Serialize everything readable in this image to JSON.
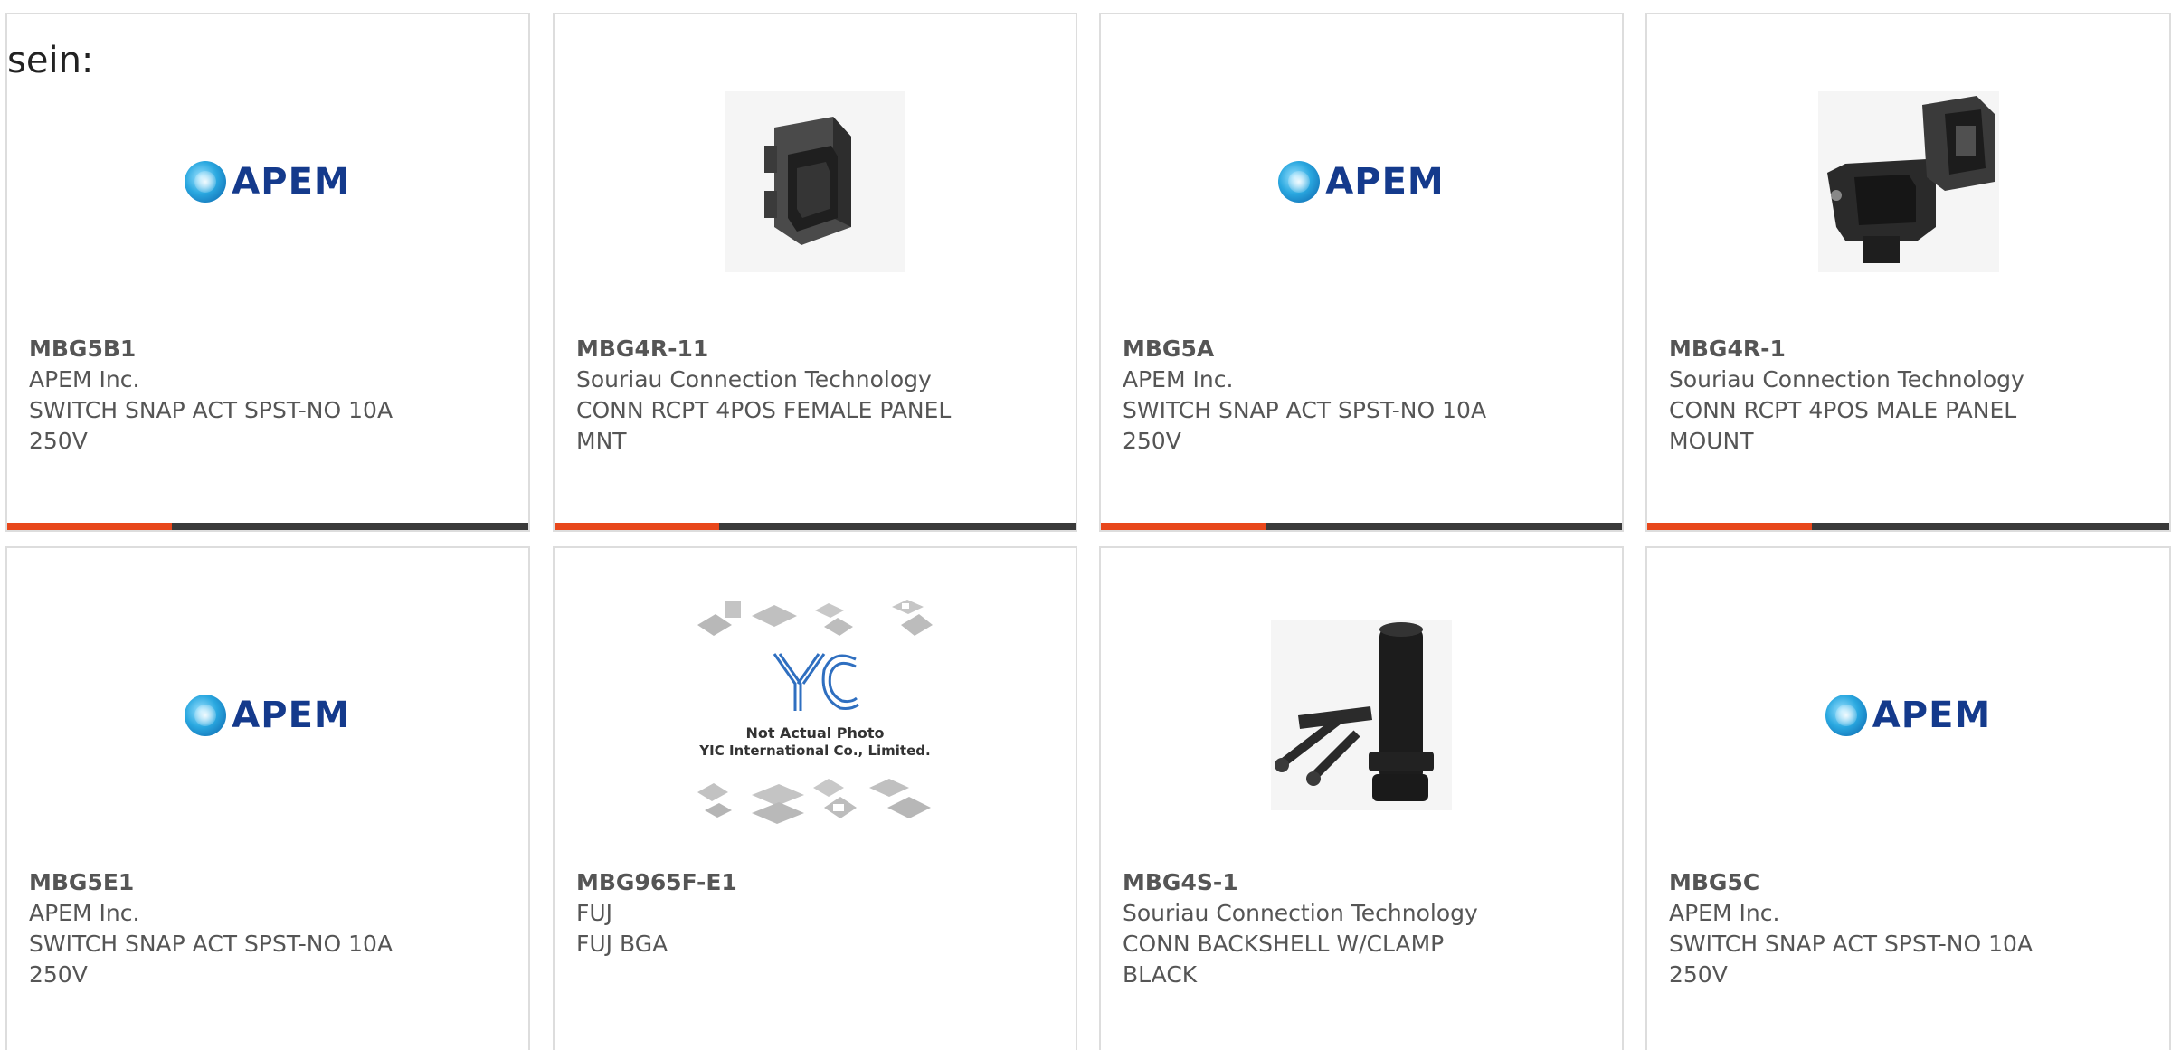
{
  "intro_text": "sein:",
  "products": [
    {
      "pn": "MBG5B1",
      "maker": "APEM Inc.",
      "desc1": "SWITCH SNAP ACT SPST-NO 10A",
      "desc2": "250V",
      "image": "apem-logo",
      "logo_text": "APEM"
    },
    {
      "pn": "MBG4R-11",
      "maker": "Souriau Connection Technology",
      "desc1": "CONN RCPT 4POS FEMALE PANEL",
      "desc2": "MNT",
      "image": "connector-receptacle-photo"
    },
    {
      "pn": "MBG5A",
      "maker": "APEM Inc.",
      "desc1": "SWITCH SNAP ACT SPST-NO 10A",
      "desc2": "250V",
      "image": "apem-logo",
      "logo_text": "APEM"
    },
    {
      "pn": "MBG4R-1",
      "maker": "Souriau Connection Technology",
      "desc1": "CONN RCPT 4POS MALE PANEL",
      "desc2": "MOUNT",
      "image": "connector-receptacle-cap-photo"
    },
    {
      "pn": "MBG5E1",
      "maker": "APEM Inc.",
      "desc1": "SWITCH SNAP ACT SPST-NO 10A",
      "desc2": "250V",
      "image": "apem-logo",
      "logo_text": "APEM"
    },
    {
      "pn": "MBG965F-E1",
      "maker": "FUJ",
      "desc1": "FUJ BGA",
      "desc2": "",
      "image": "yic-placeholder",
      "placeholder_line1": "Not Actual Photo",
      "placeholder_line2": "YIC International Co., Limited.",
      "placeholder_logo": "YIC"
    },
    {
      "pn": "MBG4S-1",
      "maker": "Souriau Connection Technology",
      "desc1": "CONN BACKSHELL W/CLAMP",
      "desc2": "BLACK",
      "image": "backshell-photo"
    },
    {
      "pn": "MBG5C",
      "maker": "APEM Inc.",
      "desc1": "SWITCH SNAP ACT SPST-NO 10A",
      "desc2": "250V",
      "image": "apem-logo",
      "logo_text": "APEM"
    }
  ],
  "colors": {
    "accent": "#e8471b",
    "bar": "#3a3a3a",
    "border": "#dddddd",
    "text": "#555555",
    "apem_blue": "#143a8c"
  }
}
